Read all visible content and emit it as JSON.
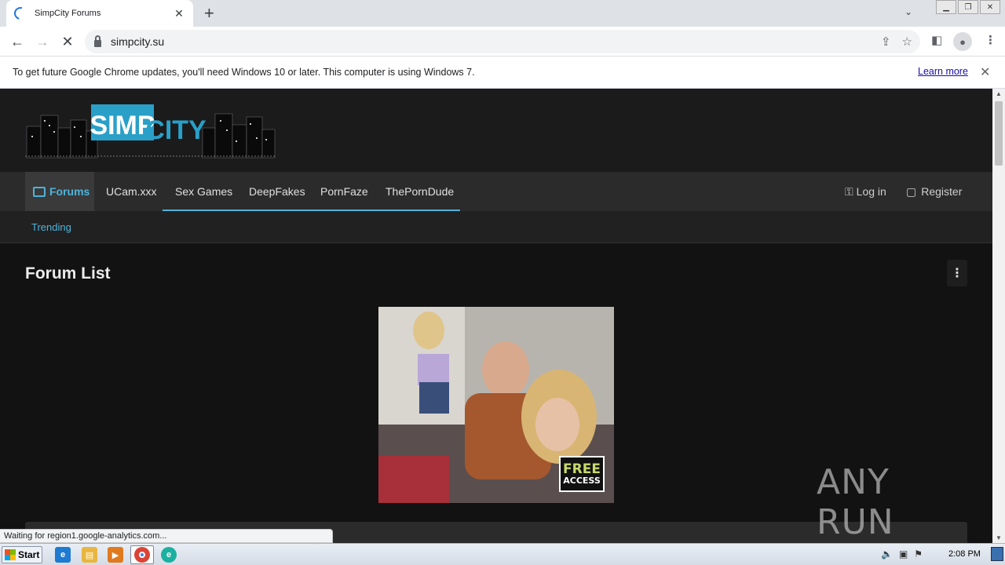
{
  "browser": {
    "tab": {
      "title": "SimpCity Forums"
    },
    "new_tab_label": "+",
    "url": "simpcity.su",
    "status_text": "Waiting for region1.google-analytics.com..."
  },
  "infobar": {
    "message": "To get future Google Chrome updates, you'll need Windows 10 or later. This computer is using Windows 7.",
    "link": "Learn more"
  },
  "site": {
    "logo_text": {
      "left": "SIMP",
      "right": "CITY"
    },
    "nav": {
      "items": [
        {
          "label": "Forums"
        },
        {
          "label": "UCam.xxx"
        },
        {
          "label": "Sex Games"
        },
        {
          "label": "DeepFakes"
        },
        {
          "label": "PornFaze"
        },
        {
          "label": "ThePornDude"
        }
      ],
      "login": "Log in",
      "register": "Register"
    },
    "subnav": {
      "trending": "Trending"
    },
    "page_title": "Forum List",
    "ad": {
      "badge_line1": "FREE",
      "badge_line2": "ACCESS"
    }
  },
  "watermark": "ANY RUN",
  "taskbar": {
    "start": "Start",
    "clock": "2:08 PM"
  },
  "colors": {
    "accent": "#4fb3d9",
    "page_bg": "#121213",
    "navbar_bg": "#2b2b2c"
  }
}
